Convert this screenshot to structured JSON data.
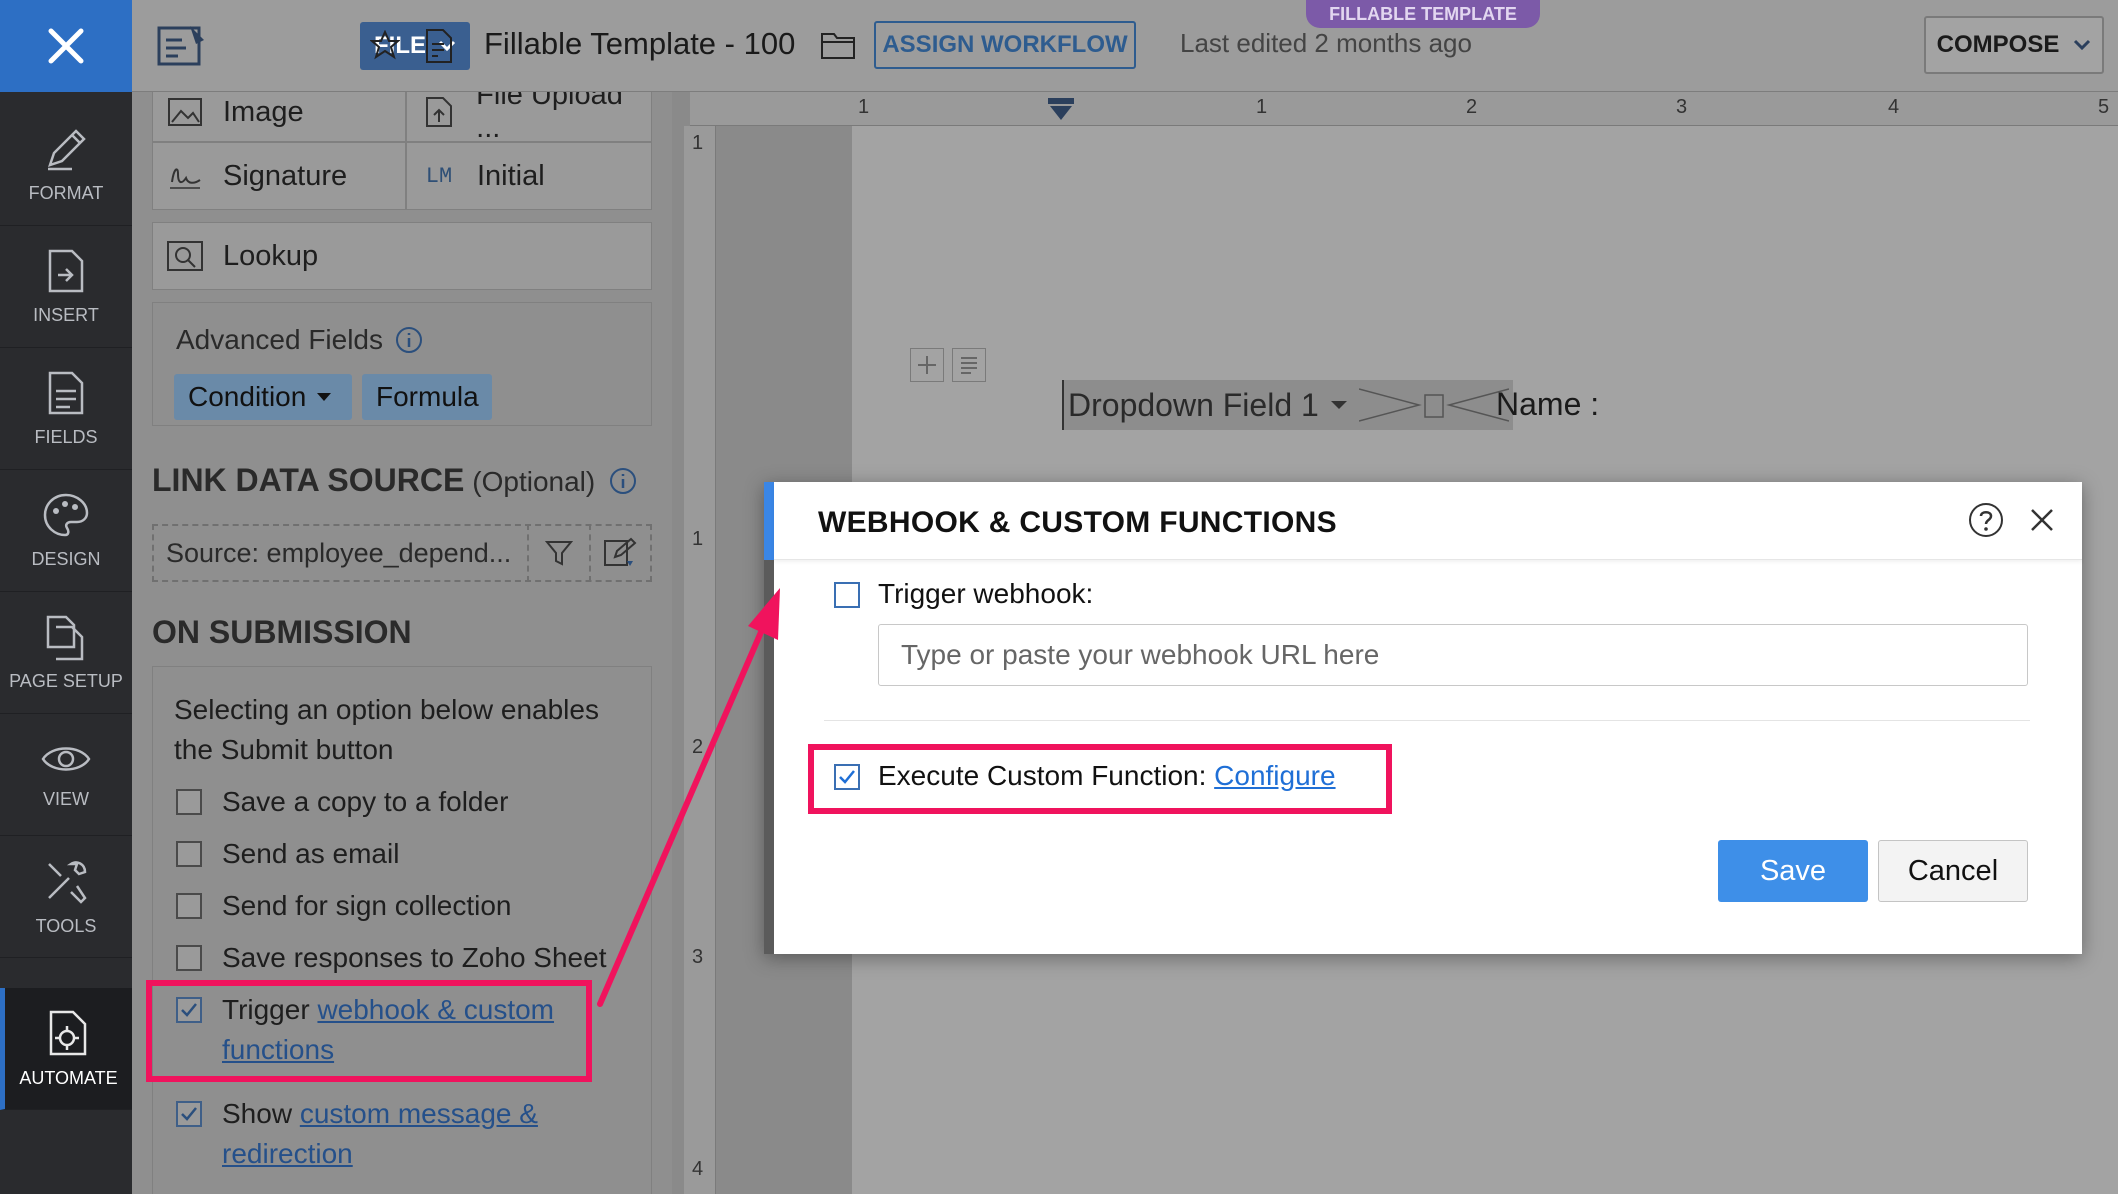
{
  "rail": {
    "items": [
      {
        "label": "FORMAT",
        "icon": "pen-icon"
      },
      {
        "label": "INSERT",
        "icon": "insert-icon"
      },
      {
        "label": "FIELDS",
        "icon": "fields-icon"
      },
      {
        "label": "DESIGN",
        "icon": "palette-icon"
      },
      {
        "label": "PAGE SETUP",
        "icon": "page-setup-icon"
      },
      {
        "label": "VIEW",
        "icon": "eye-icon"
      },
      {
        "label": "TOOLS",
        "icon": "tools-icon"
      },
      {
        "label": "AUTOMATE",
        "icon": "automate-icon"
      }
    ],
    "active": "AUTOMATE"
  },
  "topbar": {
    "file_label": "FILE",
    "doc_title": "Fillable Template - 100",
    "assign_label": "ASSIGN WORKFLOW",
    "last_edited": "Last edited 2 months ago",
    "badge": "FILLABLE TEMPLATE",
    "compose_label": "COMPOSE"
  },
  "panel": {
    "fields": {
      "image": "Image",
      "file_upload": "File Upload ...",
      "signature": "Signature",
      "initial": "Initial",
      "initial_icon_text": "LM",
      "lookup": "Lookup"
    },
    "advanced": {
      "title": "Advanced Fields",
      "condition": "Condition",
      "formula": "Formula"
    },
    "link_source": {
      "title": "LINK DATA SOURCE",
      "optional": "(Optional)",
      "source_text": "Source:  employee_depend..."
    },
    "submission": {
      "title": "ON SUBMISSION",
      "intro": "Selecting an option below enables the Submit button",
      "options": [
        {
          "text": "Save a copy to a folder",
          "checked": false
        },
        {
          "text": "Send as email",
          "checked": false
        },
        {
          "text": "Send for sign collection",
          "checked": false
        },
        {
          "text": "Save responses to Zoho Sheet",
          "checked": false
        }
      ],
      "trigger_prefix": "Trigger ",
      "trigger_link": "webhook & custom functions",
      "trigger_checked": true,
      "show_prefix": "Show ",
      "show_link": "custom message & redirection",
      "show_checked": true
    }
  },
  "canvas": {
    "ruler_h": [
      "1",
      "1",
      "2",
      "3",
      "4",
      "5"
    ],
    "ruler_v": [
      "1",
      "1",
      "2",
      "3",
      "4"
    ],
    "dropdown_field": "Dropdown Field 1",
    "name_label": "Name :"
  },
  "modal": {
    "title": "WEBHOOK & CUSTOM FUNCTIONS",
    "trigger_webhook_label": "Trigger webhook:",
    "trigger_webhook_checked": false,
    "webhook_placeholder": "Type or paste your webhook URL here",
    "execute_label": "Execute Custom Function:",
    "execute_checked": true,
    "configure_link": "Configure",
    "save_label": "Save",
    "cancel_label": "Cancel"
  },
  "colors": {
    "accent": "#2d6fc4",
    "highlight": "#f0135d",
    "save": "#3e8fe8",
    "badge": "#7c5aa8"
  }
}
